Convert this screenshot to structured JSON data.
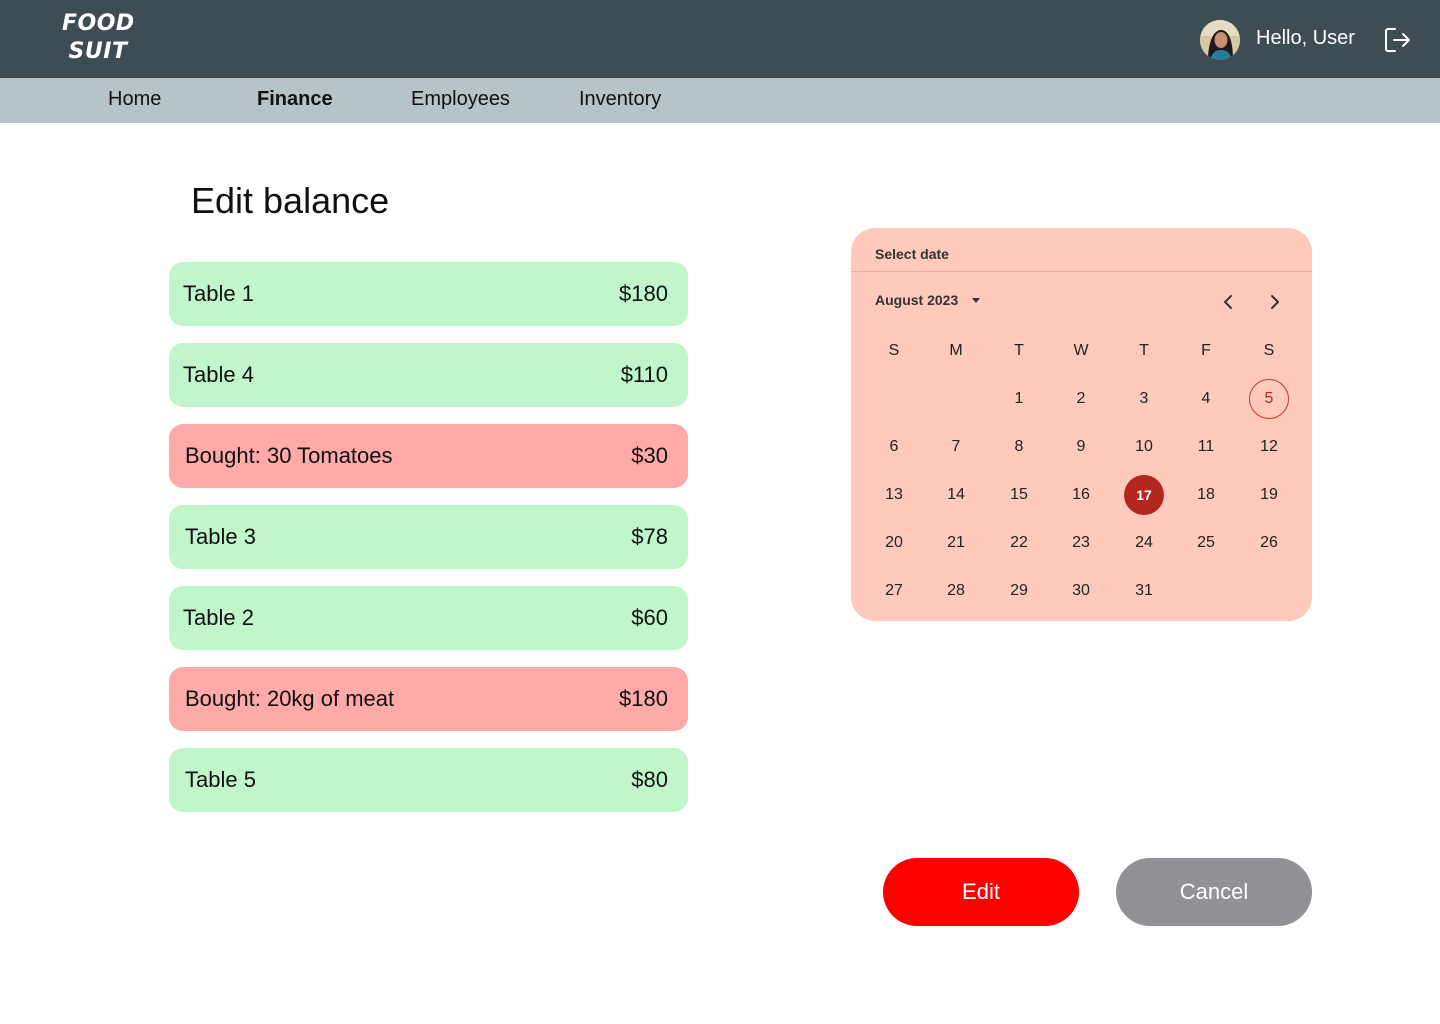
{
  "header": {
    "logo_line1": "FOOD",
    "logo_line2": "SUIT",
    "greeting": "Hello, User",
    "avatar_icon": "user-avatar",
    "logout_icon": "logout-icon"
  },
  "nav": {
    "items": [
      {
        "label": "Home",
        "active": false
      },
      {
        "label": "Finance",
        "active": true
      },
      {
        "label": "Employees",
        "active": false
      },
      {
        "label": "Inventory",
        "active": false
      }
    ]
  },
  "page": {
    "title": "Edit balance"
  },
  "entries": [
    {
      "label": "Table 1",
      "amount": "$180",
      "kind": "income"
    },
    {
      "label": "Table 4",
      "amount": "$110",
      "kind": "income"
    },
    {
      "label": "Bought: 30 Tomatoes",
      "amount": "$30",
      "kind": "expense"
    },
    {
      "label": "Table 3",
      "amount": "$78",
      "kind": "income"
    },
    {
      "label": "Table 2",
      "amount": "$60",
      "kind": "income"
    },
    {
      "label": "Bought: 20kg of meat",
      "amount": "$180",
      "kind": "expense"
    },
    {
      "label": "Table 5",
      "amount": "$80",
      "kind": "income"
    }
  ],
  "calendar": {
    "header": "Select date",
    "month_label": "August 2023",
    "weekdays": [
      "S",
      "M",
      "T",
      "W",
      "T",
      "F",
      "S"
    ],
    "days": [
      "1",
      "2",
      "3",
      "4",
      "5",
      "6",
      "7",
      "8",
      "9",
      "10",
      "11",
      "12",
      "13",
      "14",
      "15",
      "16",
      "17",
      "18",
      "19",
      "20",
      "21",
      "22",
      "23",
      "24",
      "25",
      "26",
      "27",
      "28",
      "29",
      "30",
      "31"
    ],
    "first_weekday_index": 2,
    "today": "5",
    "selected": "17",
    "colors": {
      "background": "#ffcabb",
      "selected": "#b3271f",
      "today_ring": "#c8322b"
    }
  },
  "actions": {
    "edit_label": "Edit",
    "cancel_label": "Cancel"
  },
  "colors": {
    "topbar": "#3d4d53",
    "navbar": "#b6c3c7",
    "income": "#c0f6c9",
    "expense": "#feaaa8",
    "edit_button": "#ff0000",
    "cancel_button": "#919196"
  }
}
